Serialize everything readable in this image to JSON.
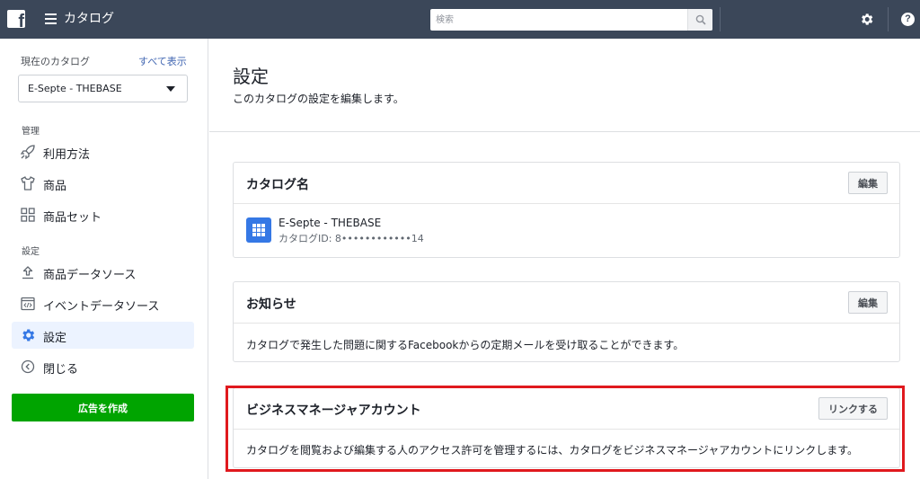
{
  "topbar": {
    "logo_letter": "f",
    "app_title": "カタログ",
    "search_placeholder": "検索",
    "help_label": "?"
  },
  "sidebar": {
    "current_catalog_label": "現在のカタログ",
    "show_all_link": "すべて表示",
    "selected_catalog": "E-Septe - THEBASE",
    "section_manage": "管理",
    "section_settings": "設定",
    "items": [
      {
        "label": "利用方法",
        "icon": "rocket-icon"
      },
      {
        "label": "商品",
        "icon": "tshirt-icon"
      },
      {
        "label": "商品セット",
        "icon": "grid-icon"
      },
      {
        "label": "商品データソース",
        "icon": "upload-icon"
      },
      {
        "label": "イベントデータソース",
        "icon": "code-window-icon"
      },
      {
        "label": "設定",
        "icon": "gear-icon",
        "active": true
      },
      {
        "label": "閉じる",
        "icon": "collapse-icon"
      }
    ],
    "create_ad_button": "広告を作成"
  },
  "main": {
    "title": "設定",
    "subtitle": "このカタログの設定を編集します。",
    "cards": {
      "catalog_name": {
        "title": "カタログ名",
        "button": "編集",
        "name": "E-Septe - THEBASE",
        "id_text": "カタログID: 8••••••••••••14"
      },
      "notifications": {
        "title": "お知らせ",
        "button": "編集",
        "body": "カタログで発生した問題に関するFacebookからの定期メールを受け取ることができます。"
      },
      "business_manager": {
        "title": "ビジネスマネージャアカウント",
        "button": "リンクする",
        "body": "カタログを閲覧および編集する人のアクセス許可を管理するには、カタログをビジネスマネージャアカウントにリンクします。"
      }
    }
  },
  "colors": {
    "topbar": "#3b4759",
    "accent_link": "#4267b2",
    "active_nav": "#ecf3ff",
    "create_ad": "#00a400",
    "highlight": "#e0191e",
    "catalog_icon": "#3578e5"
  }
}
